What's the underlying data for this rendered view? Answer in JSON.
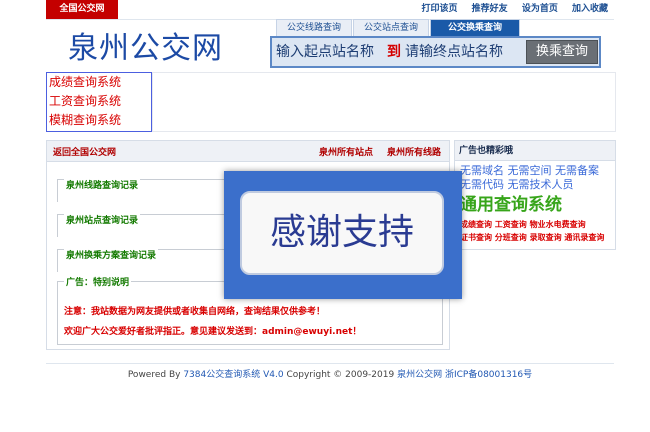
{
  "topbar": {
    "home_link": "全国公交网",
    "links": [
      "打印该页",
      "推荐好友",
      "设为首页",
      "加入收藏"
    ]
  },
  "header": {
    "logo": "泉州公交网",
    "tabs": [
      "公交线路查询",
      "公交站点查询",
      "公交换乘查询"
    ],
    "search": {
      "start_placeholder": "输入起点站名称",
      "to_label": "到",
      "end_placeholder": "请输终点站名称",
      "button_label": "换乘查询"
    }
  },
  "toolbox": [
    "成绩查询系统",
    "工资查询系统",
    "模糊查询系统"
  ],
  "main": {
    "back_link": "返回全国公交网",
    "all_stations": "泉州所有站点",
    "all_lines": "泉州所有线路",
    "sections": [
      "泉州线路查询记录",
      "泉州站点查询记录",
      "泉州换乘方案查询记录"
    ],
    "ad_legend": "广告：特别说明",
    "notice1": "注意：我站数据为网友提供或者收集自网络，查询结果仅供参考！",
    "notice2": "欢迎广大公交爱好者批评指正。意见建议发送到：admin@ewuyi.net！"
  },
  "side": {
    "title": "广告也精彩哦",
    "line1": "无需域名 无需空间 无需备案",
    "line2": "无需代码 无需技术人员",
    "big": "通用查询系统",
    "line3": "成绩查询 工资查询 物业水电费查询",
    "line4": "证书查询 分班查询 录取查询 通讯录查询"
  },
  "overlay": {
    "text": "感谢支持"
  },
  "footer": {
    "powered": "Powered By",
    "system": "7384公交查询系统 V4.0",
    "copyright": "Copyright © 2009-2019",
    "site": "泉州公交网",
    "icp": "浙ICP备08001316号"
  },
  "colors": {
    "brand_blue": "#1c4aa5",
    "accent_red": "#d80000",
    "link_green": "#137a00"
  }
}
